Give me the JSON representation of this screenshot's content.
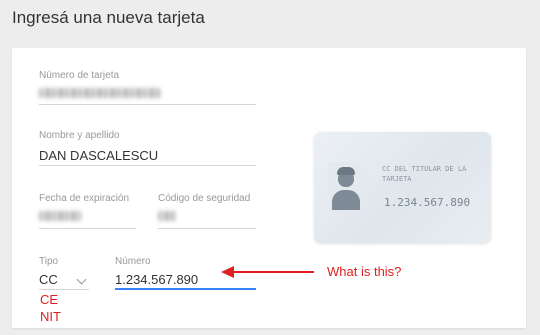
{
  "page": {
    "title": "Ingresá una nueva tarjeta"
  },
  "form": {
    "card_number": {
      "label": "Número de tarjeta"
    },
    "name": {
      "label": "Nombre y apellido",
      "value": "DAN DASCALESCU"
    },
    "expiry": {
      "label": "Fecha de expiración"
    },
    "security": {
      "label": "Código de seguridad"
    },
    "doc_type": {
      "label": "Tipo",
      "value": "CC"
    },
    "doc_number": {
      "label": "Número",
      "value": "1.234.567.890"
    }
  },
  "card_preview": {
    "title": "CC DEL TITULAR DE LA TARJETA",
    "number": "1.234.567.890"
  },
  "annotations": {
    "question": "What is this?",
    "options": [
      "CE",
      "NIT"
    ],
    "color": "#e02020"
  },
  "colors": {
    "accent": "#3483fa"
  }
}
